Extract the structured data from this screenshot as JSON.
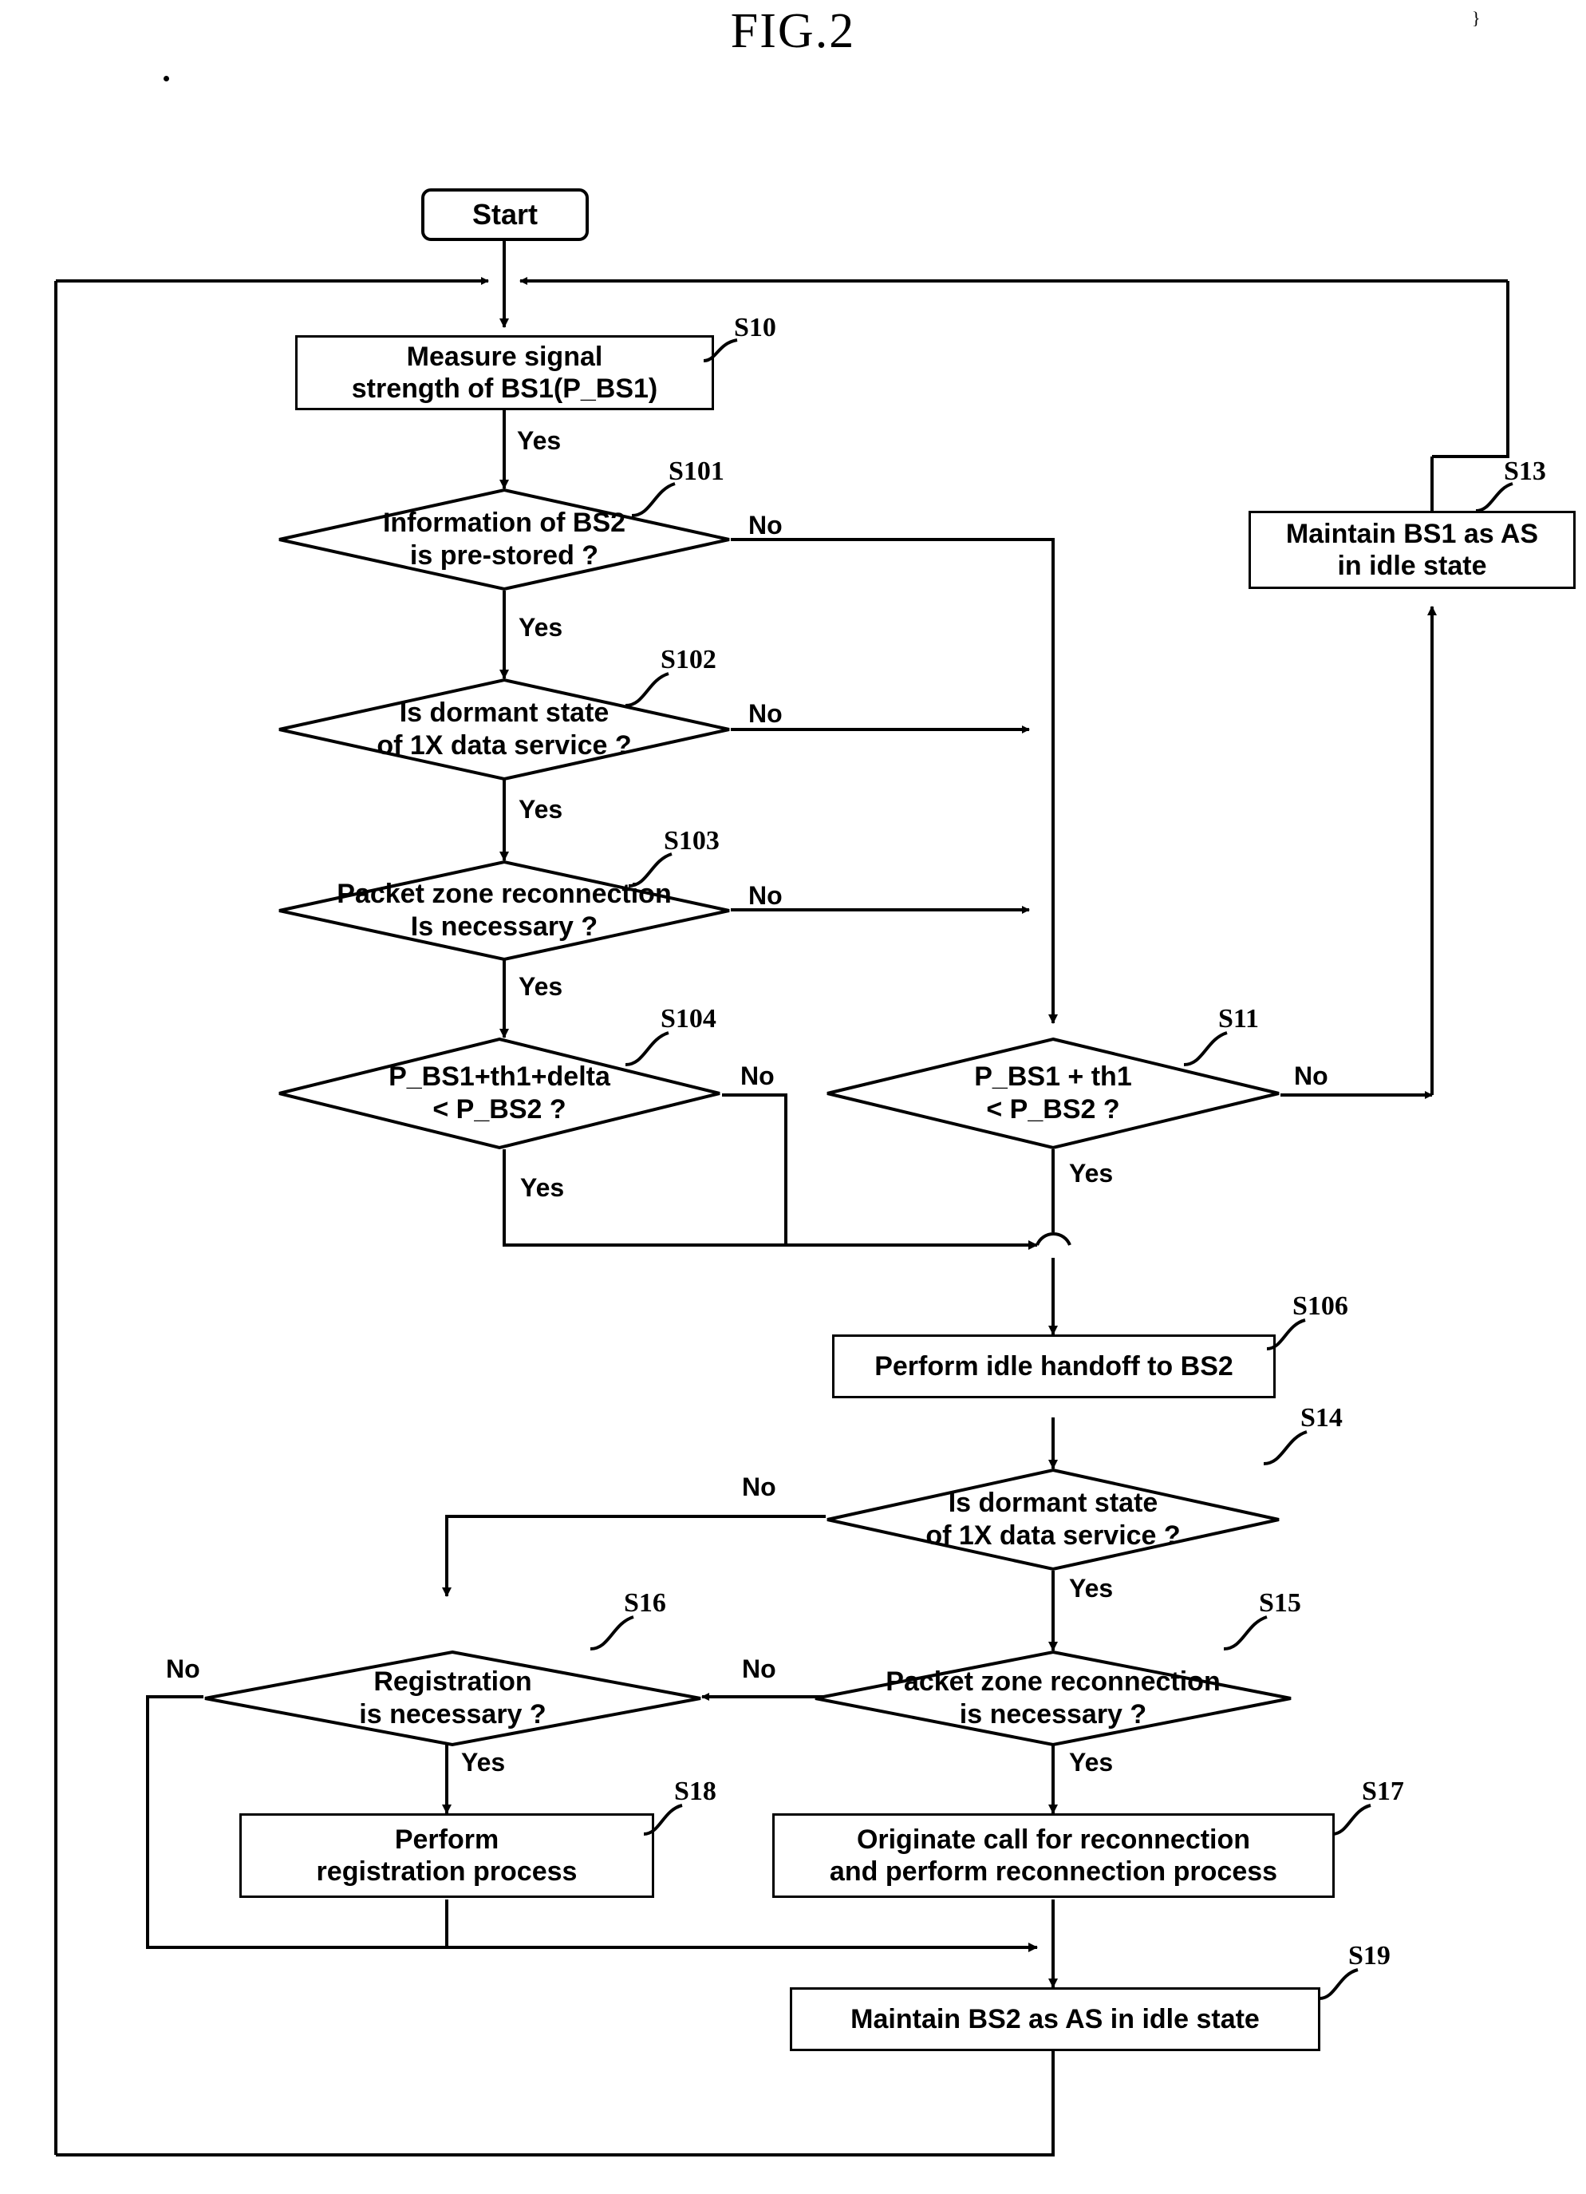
{
  "figure": {
    "title": "FIG.2",
    "corner_mark": "}"
  },
  "nodes": {
    "start": {
      "label": "Start"
    },
    "s10": {
      "tag": "S10",
      "line1": "Measure signal",
      "line2": "strength of BS1(P_BS1)"
    },
    "s101": {
      "tag": "S101",
      "line1": "Information of BS2",
      "line2": "is pre-stored ?"
    },
    "s102": {
      "tag": "S102",
      "line1": "Is dormant state",
      "line2": "of 1X data service ?"
    },
    "s103": {
      "tag": "S103",
      "line1": "Packet zone reconnection",
      "line2": "Is necessary ?"
    },
    "s104": {
      "tag": "S104",
      "line1": "P_BS1+th1+delta",
      "line2": "< P_BS2 ?"
    },
    "s11": {
      "tag": "S11",
      "line1": "P_BS1 + th1",
      "line2": "< P_BS2 ?"
    },
    "s13": {
      "tag": "S13",
      "line1": "Maintain BS1 as AS",
      "line2": "in idle state"
    },
    "s106": {
      "tag": "S106",
      "line1": "Perform idle handoff to BS2"
    },
    "s14": {
      "tag": "S14",
      "line1": "Is dormant state",
      "line2": "of 1X data service ?"
    },
    "s15": {
      "tag": "S15",
      "line1": "Packet zone reconnection",
      "line2": "is necessary ?"
    },
    "s16": {
      "tag": "S16",
      "line1": "Registration",
      "line2": "is necessary ?"
    },
    "s17": {
      "tag": "S17",
      "line1": "Originate call for reconnection",
      "line2": "and perform reconnection process"
    },
    "s18": {
      "tag": "S18",
      "line1": "Perform",
      "line2": "registration process"
    },
    "s19": {
      "tag": "S19",
      "line1": "Maintain BS2 as AS in idle state"
    }
  },
  "edge_labels": {
    "s10_yes": "Yes",
    "s101_no": "No",
    "s101_yes": "Yes",
    "s102_no": "No",
    "s102_yes": "Yes",
    "s103_no": "No",
    "s103_yes": "Yes",
    "s104_no": "No",
    "s104_yes": "Yes",
    "s11_no": "No",
    "s11_yes": "Yes",
    "s14_no": "No",
    "s14_yes": "Yes",
    "s15_no": "No",
    "s15_yes": "Yes",
    "s16_no": "No",
    "s16_yes": "Yes"
  },
  "colors": {
    "ink": "#000000",
    "paper": "#ffffff"
  }
}
